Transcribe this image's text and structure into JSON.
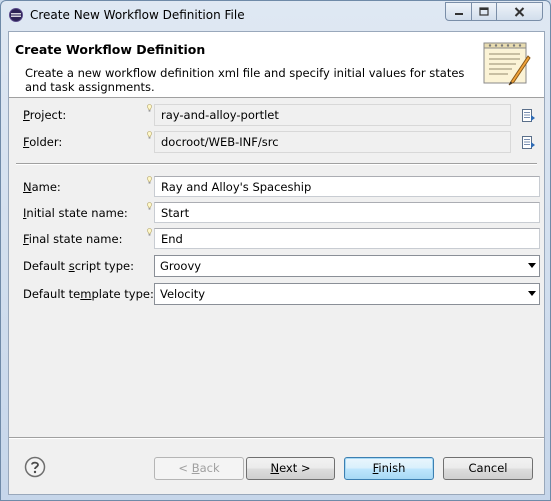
{
  "window": {
    "title": "Create New Workflow Definition File",
    "icon": "eclipse-icon",
    "controls": [
      "minimize-icon",
      "maximize-icon",
      "close-icon"
    ]
  },
  "banner": {
    "title": "Create Workflow Definition",
    "description": "Create a new workflow definition xml file and specify initial values for states and task assignments.",
    "icon": "form-pencil-icon"
  },
  "project": {
    "mnemonic": "P",
    "rest": "roject:",
    "value": "ray-and-alloy-portlet"
  },
  "folder": {
    "mnemonic": "F",
    "rest": "older:",
    "value": "docroot/WEB-INF/src"
  },
  "name": {
    "mnemonic": "N",
    "rest": "ame:",
    "value": "Ray and Alloy's Spaceship"
  },
  "initial_state": {
    "mnemonic": "I",
    "rest": "nitial state name:",
    "value": "Start"
  },
  "final_state": {
    "mnemonic": "F",
    "rest": "inal state name:",
    "value": "End"
  },
  "script_type": {
    "pre": "Default ",
    "mnemonic": "s",
    "rest": "cript type:",
    "value": "Groovy"
  },
  "template_type": {
    "pre": "Default te",
    "mnemonic": "m",
    "rest": "plate type:",
    "value": "Velocity"
  },
  "buttons": {
    "back_pre": "< ",
    "back_mnemonic": "B",
    "back_rest": "ack",
    "next_mnemonic": "N",
    "next_rest": "ext >",
    "finish_mnemonic": "F",
    "finish_rest": "inish",
    "cancel": "Cancel"
  },
  "colors": {
    "accent": "#3c7fb1",
    "window_frame": "#c6d6ea",
    "dialog_bg": "#f0f0f0"
  }
}
